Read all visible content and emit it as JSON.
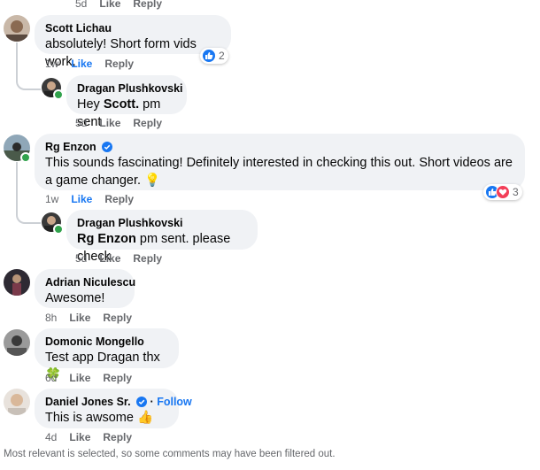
{
  "top_actions": {
    "time": "5d",
    "like": "Like",
    "reply": "Reply"
  },
  "comments": [
    {
      "author": "Scott Lichau",
      "text": "absolutely! Short form vids work,",
      "time": "1w",
      "like": "Like",
      "reply": "Reply",
      "reaction_count": "2",
      "reply_item": {
        "author": "Dragan Plushkovski",
        "text_prefix": "Hey ",
        "mention": "Scott.",
        "text_suffix": " pm sent",
        "time": "5d",
        "like": "Like",
        "reply": "Reply"
      }
    },
    {
      "author": "Rg Enzon",
      "text": "This sounds fascinating! Definitely interested in checking this out. Short videos are a game changer.",
      "text_emoji": "💡",
      "time": "1w",
      "like": "Like",
      "reply": "Reply",
      "reaction_count": "3",
      "reply_item": {
        "author": "Dragan Plushkovski",
        "mention": "Rg Enzon",
        "text_suffix": " pm sent. please check",
        "time": "5d",
        "like": "Like",
        "reply": "Reply"
      }
    },
    {
      "author": "Adrian Niculescu",
      "text": "Awesome!",
      "time": "8h",
      "like": "Like",
      "reply": "Reply"
    },
    {
      "author": "Domonic Mongello",
      "text": "Test app Dragan thx",
      "text_emoji": "🍀",
      "time": "6d",
      "like": "Like",
      "reply": "Reply"
    },
    {
      "author": "Daniel Jones Sr.",
      "follow": "Follow",
      "follow_separator": "·",
      "text": "This is awsome",
      "text_emoji": "👍",
      "time": "4d",
      "like": "Like",
      "reply": "Reply"
    }
  ],
  "footer": "Most relevant is selected, so some comments may have been filtered out.",
  "colors": {
    "like_blue": "#1877f2",
    "love_red": "#f33e58",
    "bubble_bg": "#f0f2f5",
    "meta_gray": "#65676b",
    "online_green": "#31a24c"
  }
}
